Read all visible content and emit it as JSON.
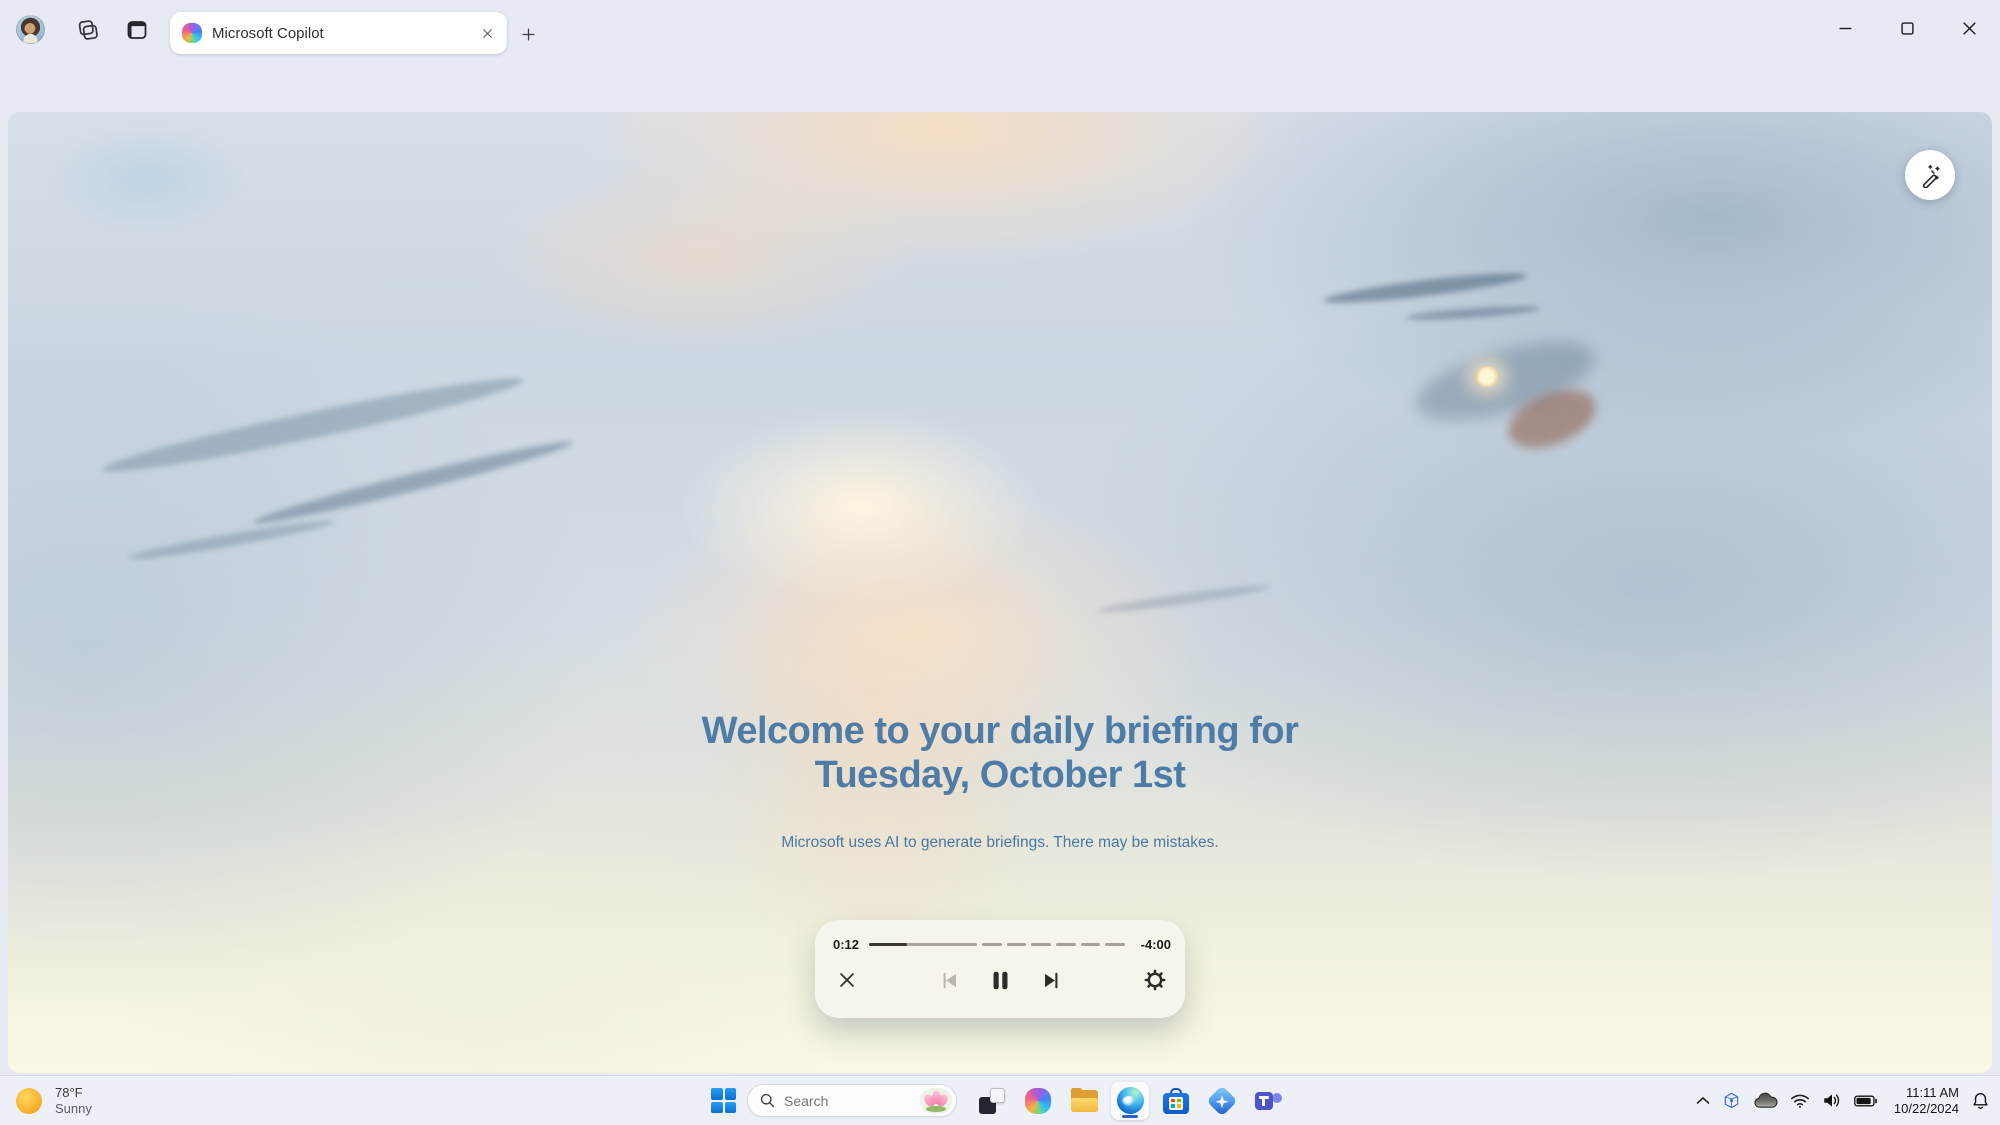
{
  "browser": {
    "tab_title": "Microsoft Copilot",
    "url": "https://copilot.microsoft.com"
  },
  "briefing": {
    "title_line1": "Welcome to your daily briefing for",
    "title_line2": "Tuesday, October 1st",
    "disclaimer": "Microsoft uses AI to generate briefings. There may be mistakes.",
    "player": {
      "elapsed": "0:12",
      "remaining": "-4:00"
    }
  },
  "taskbar": {
    "weather_temp": "78°F",
    "weather_condition": "Sunny",
    "search_placeholder": "Search",
    "time": "11:11 AM",
    "date": "10/22/2024"
  },
  "icons": {
    "player": [
      "close-icon",
      "previous-track-icon",
      "pause-icon",
      "next-track-icon",
      "settings-gear-icon"
    ],
    "toolbar": [
      "back-icon",
      "refresh-icon",
      "lock-icon",
      "add-favorite-icon",
      "favorites-icon",
      "more-icon",
      "copilot-icon"
    ],
    "page": [
      "magic-wand-icon"
    ]
  },
  "colors": {
    "title_blue": "#4e7ca6",
    "player_background": "#f7f4ec",
    "progress_played": "#3a3733",
    "chrome_background": "#e7eaf3",
    "taskbar_background": "#eef0f8",
    "edge_active_underline": "#2a5fd0"
  }
}
